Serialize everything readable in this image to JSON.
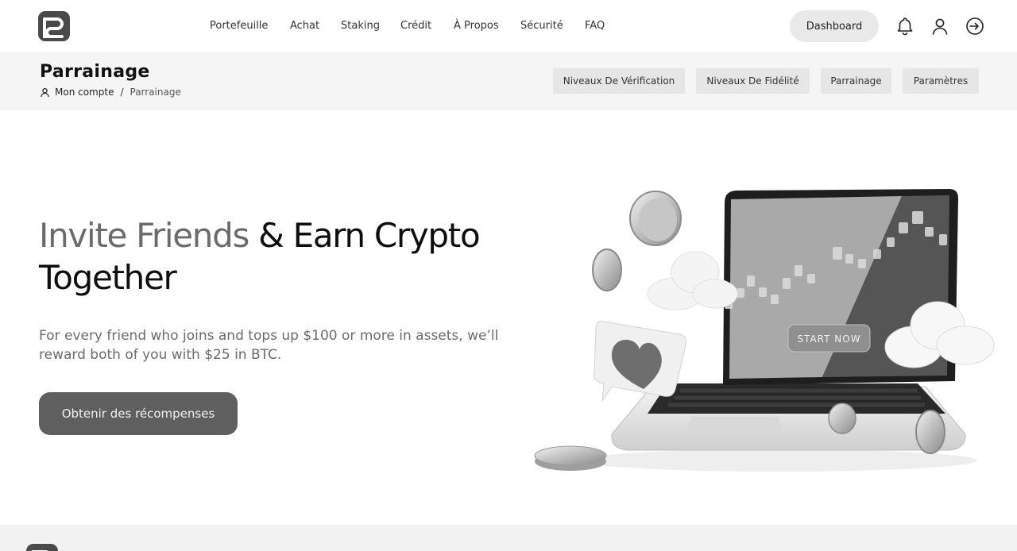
{
  "nav": {
    "items": [
      "Portefeuille",
      "Achat",
      "Staking",
      "Crédit",
      "À Propos",
      "Sécurité",
      "FAQ"
    ],
    "dashboard_label": "Dashboard"
  },
  "icons": {
    "bell": "bell-icon",
    "user": "user-icon",
    "logout": "logout-icon"
  },
  "subheader": {
    "title": "Parrainage",
    "breadcrumb": {
      "root": "Mon compte",
      "separator": "/",
      "current": "Parrainage"
    },
    "tabs": [
      "Niveaux De Vérification",
      "Niveaux De Fidélité",
      "Parrainage",
      "Paramètres"
    ]
  },
  "hero": {
    "title_light": "Invite Friends",
    "title_dark": "& Earn Crypto Together",
    "description": "For every friend who joins and tops up $100 or more in assets, we’ll reward both of you with $25 in BTC.",
    "cta_label": "Obtenir des récompenses",
    "illustration_button": "START NOW"
  },
  "colors": {
    "page_bg": "#ffffff",
    "subheader_bg": "#f5f5f5",
    "tab_bg": "#e6e6e6",
    "cta_bg": "#5f5f5f",
    "dashboard_bg": "#e9e9e9"
  }
}
